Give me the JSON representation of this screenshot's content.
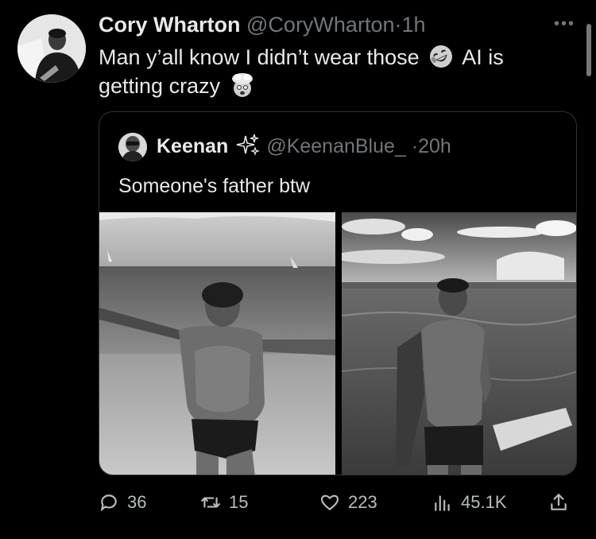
{
  "tweet": {
    "author_name": "Cory Wharton",
    "author_handle": "@CoryWharton",
    "separator": "·",
    "time": "1h",
    "text_part1": "Man y’all know I didn’t wear those",
    "text_part2": "AI is getting crazy",
    "emoji_1": "rolling-on-floor-laughing-emoji",
    "emoji_2": "exploding-head-emoji",
    "more_label": "•••"
  },
  "quote": {
    "author_name": "Keenan",
    "author_handle": "@KeenanBlue_",
    "separator": "·",
    "time": "20h",
    "text": "Someone's father btw",
    "badge_icon": "sparkles-icon"
  },
  "actions": {
    "replies": "36",
    "retweets": "15",
    "likes": "223",
    "views": "45.1K"
  },
  "colors": {
    "background": "#000000",
    "text": "#e7e9ea",
    "muted": "#71767b",
    "border": "#2f3336"
  }
}
